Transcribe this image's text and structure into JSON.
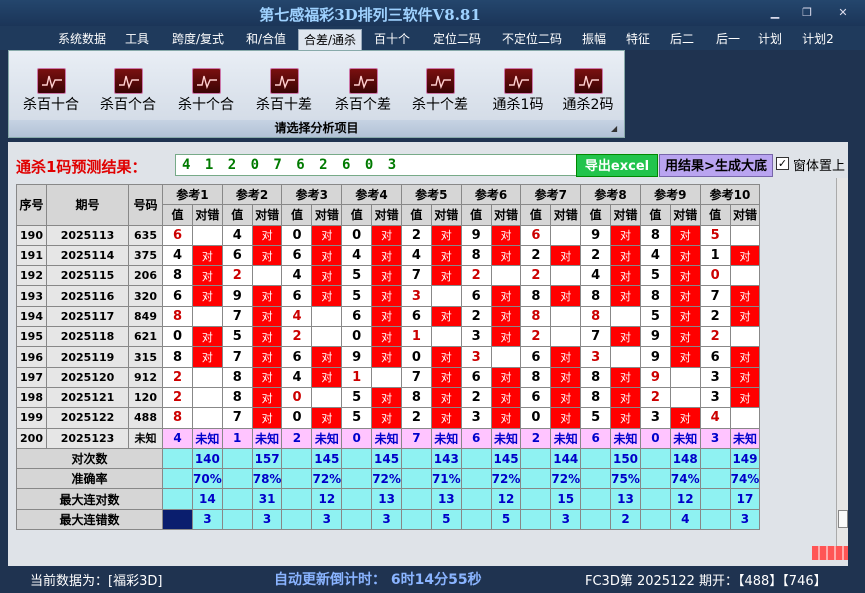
{
  "window": {
    "title": "第七感福彩3D排列三软件V8.81"
  },
  "menu": [
    "系统数据",
    "工具",
    "跨度/复式",
    "和/合值",
    "合差/通杀",
    "百十个",
    "定位二码",
    "不定位二码",
    "振幅",
    "特征",
    "后二",
    "后一",
    "计划",
    "计划2"
  ],
  "active_menu_index": 4,
  "ribbon": {
    "buttons": [
      "杀百十合",
      "杀百个合",
      "杀十个合",
      "杀百十差",
      "杀百个差",
      "杀十个差",
      "通杀1码",
      "通杀2码"
    ],
    "caption": "请选择分析项目"
  },
  "prediction": {
    "label": "通杀1码预测结果：",
    "value": "4 1 2 0 7 6 2 6 0 3",
    "export_button": "导出excel",
    "generate_button": "用结果>生成大底",
    "topmost_label": "窗体置上",
    "topmost_checked": "✓"
  },
  "table": {
    "headers": {
      "seq": "序号",
      "period": "期号",
      "number": "号码",
      "value": "值",
      "result": "对错"
    },
    "refs": [
      "参考1",
      "参考2",
      "参考3",
      "参考4",
      "参考5",
      "参考6",
      "参考7",
      "参考8",
      "参考9",
      "参考10"
    ],
    "rows": [
      {
        "seq": "190",
        "period": "2025113",
        "number": "635",
        "vals": [
          "6",
          "4",
          "0",
          "0",
          "2",
          "9",
          "6",
          "9",
          "8",
          "5"
        ],
        "marks": [
          0,
          1,
          1,
          1,
          1,
          1,
          0,
          1,
          1,
          0
        ],
        "red": [
          1,
          0,
          0,
          0,
          0,
          0,
          1,
          0,
          0,
          1
        ]
      },
      {
        "seq": "191",
        "period": "2025114",
        "number": "375",
        "vals": [
          "4",
          "6",
          "6",
          "4",
          "4",
          "8",
          "2",
          "2",
          "4",
          "1"
        ],
        "marks": [
          1,
          1,
          1,
          1,
          1,
          1,
          1,
          1,
          1,
          1
        ],
        "red": [
          0,
          0,
          0,
          0,
          0,
          0,
          0,
          0,
          0,
          0
        ]
      },
      {
        "seq": "192",
        "period": "2025115",
        "number": "206",
        "vals": [
          "8",
          "2",
          "4",
          "5",
          "7",
          "2",
          "2",
          "4",
          "5",
          "0"
        ],
        "marks": [
          1,
          0,
          1,
          1,
          1,
          0,
          0,
          1,
          1,
          0
        ],
        "red": [
          0,
          1,
          0,
          0,
          0,
          1,
          1,
          0,
          0,
          1
        ]
      },
      {
        "seq": "193",
        "period": "2025116",
        "number": "320",
        "vals": [
          "6",
          "9",
          "6",
          "5",
          "3",
          "6",
          "8",
          "8",
          "8",
          "7"
        ],
        "marks": [
          1,
          1,
          1,
          1,
          0,
          1,
          1,
          1,
          1,
          1
        ],
        "red": [
          0,
          0,
          0,
          0,
          1,
          0,
          0,
          0,
          0,
          0
        ]
      },
      {
        "seq": "194",
        "period": "2025117",
        "number": "849",
        "vals": [
          "8",
          "7",
          "4",
          "6",
          "6",
          "2",
          "8",
          "8",
          "5",
          "2"
        ],
        "marks": [
          0,
          1,
          0,
          1,
          1,
          1,
          0,
          0,
          1,
          1
        ],
        "red": [
          1,
          0,
          1,
          0,
          0,
          0,
          1,
          1,
          0,
          0
        ]
      },
      {
        "seq": "195",
        "period": "2025118",
        "number": "621",
        "vals": [
          "0",
          "5",
          "2",
          "0",
          "1",
          "3",
          "2",
          "7",
          "9",
          "2"
        ],
        "marks": [
          1,
          1,
          0,
          1,
          0,
          1,
          0,
          1,
          1,
          0
        ],
        "red": [
          0,
          0,
          1,
          0,
          1,
          0,
          1,
          0,
          0,
          1
        ]
      },
      {
        "seq": "196",
        "period": "2025119",
        "number": "315",
        "vals": [
          "8",
          "7",
          "6",
          "9",
          "0",
          "3",
          "6",
          "3",
          "9",
          "6"
        ],
        "marks": [
          1,
          1,
          1,
          1,
          1,
          0,
          1,
          0,
          1,
          1
        ],
        "red": [
          0,
          0,
          0,
          0,
          0,
          1,
          0,
          1,
          0,
          0
        ]
      },
      {
        "seq": "197",
        "period": "2025120",
        "number": "912",
        "vals": [
          "2",
          "8",
          "4",
          "1",
          "7",
          "6",
          "8",
          "8",
          "9",
          "3"
        ],
        "marks": [
          0,
          1,
          1,
          0,
          1,
          1,
          1,
          1,
          0,
          1
        ],
        "red": [
          1,
          0,
          0,
          1,
          0,
          0,
          0,
          0,
          1,
          0
        ]
      },
      {
        "seq": "198",
        "period": "2025121",
        "number": "120",
        "vals": [
          "2",
          "8",
          "0",
          "5",
          "8",
          "2",
          "6",
          "8",
          "2",
          "3"
        ],
        "marks": [
          0,
          1,
          0,
          1,
          1,
          1,
          1,
          1,
          0,
          1
        ],
        "red": [
          1,
          0,
          1,
          0,
          0,
          0,
          0,
          0,
          1,
          0
        ]
      },
      {
        "seq": "199",
        "period": "2025122",
        "number": "488",
        "vals": [
          "8",
          "7",
          "0",
          "5",
          "2",
          "3",
          "0",
          "5",
          "3",
          "4"
        ],
        "marks": [
          0,
          1,
          1,
          1,
          1,
          1,
          1,
          1,
          1,
          0
        ],
        "red": [
          1,
          0,
          0,
          0,
          0,
          0,
          0,
          0,
          0,
          1
        ]
      }
    ],
    "pending": {
      "seq": "200",
      "period": "2025123",
      "number": "未知",
      "vals": [
        "4",
        "1",
        "2",
        "0",
        "7",
        "6",
        "2",
        "6",
        "0",
        "3"
      ],
      "unknown": "未知"
    },
    "stats": [
      {
        "label": "对次数",
        "values": [
          "140",
          "157",
          "145",
          "145",
          "143",
          "145",
          "144",
          "150",
          "148",
          "149"
        ]
      },
      {
        "label": "准确率",
        "values": [
          "70%",
          "78%",
          "72%",
          "72%",
          "71%",
          "72%",
          "72%",
          "75%",
          "74%",
          "74%"
        ]
      },
      {
        "label": "最大连对数",
        "values": [
          "14",
          "31",
          "12",
          "13",
          "13",
          "12",
          "15",
          "13",
          "12",
          "17"
        ]
      },
      {
        "label": "最大连错数",
        "values": [
          "3",
          "3",
          "3",
          "3",
          "5",
          "5",
          "3",
          "2",
          "4",
          "3"
        ]
      }
    ],
    "mark_text": "对"
  },
  "statusbar": {
    "left": "当前数据为：[福彩3D]",
    "center": "自动更新倒计时：  6时14分55秒",
    "right": "FC3D第 2025122 期开：【488】【746】"
  },
  "colors": {
    "mark": "#ff0000",
    "pending": "#ffc4ff",
    "stats": "#8ff2f2",
    "accent": "#22c44c"
  }
}
